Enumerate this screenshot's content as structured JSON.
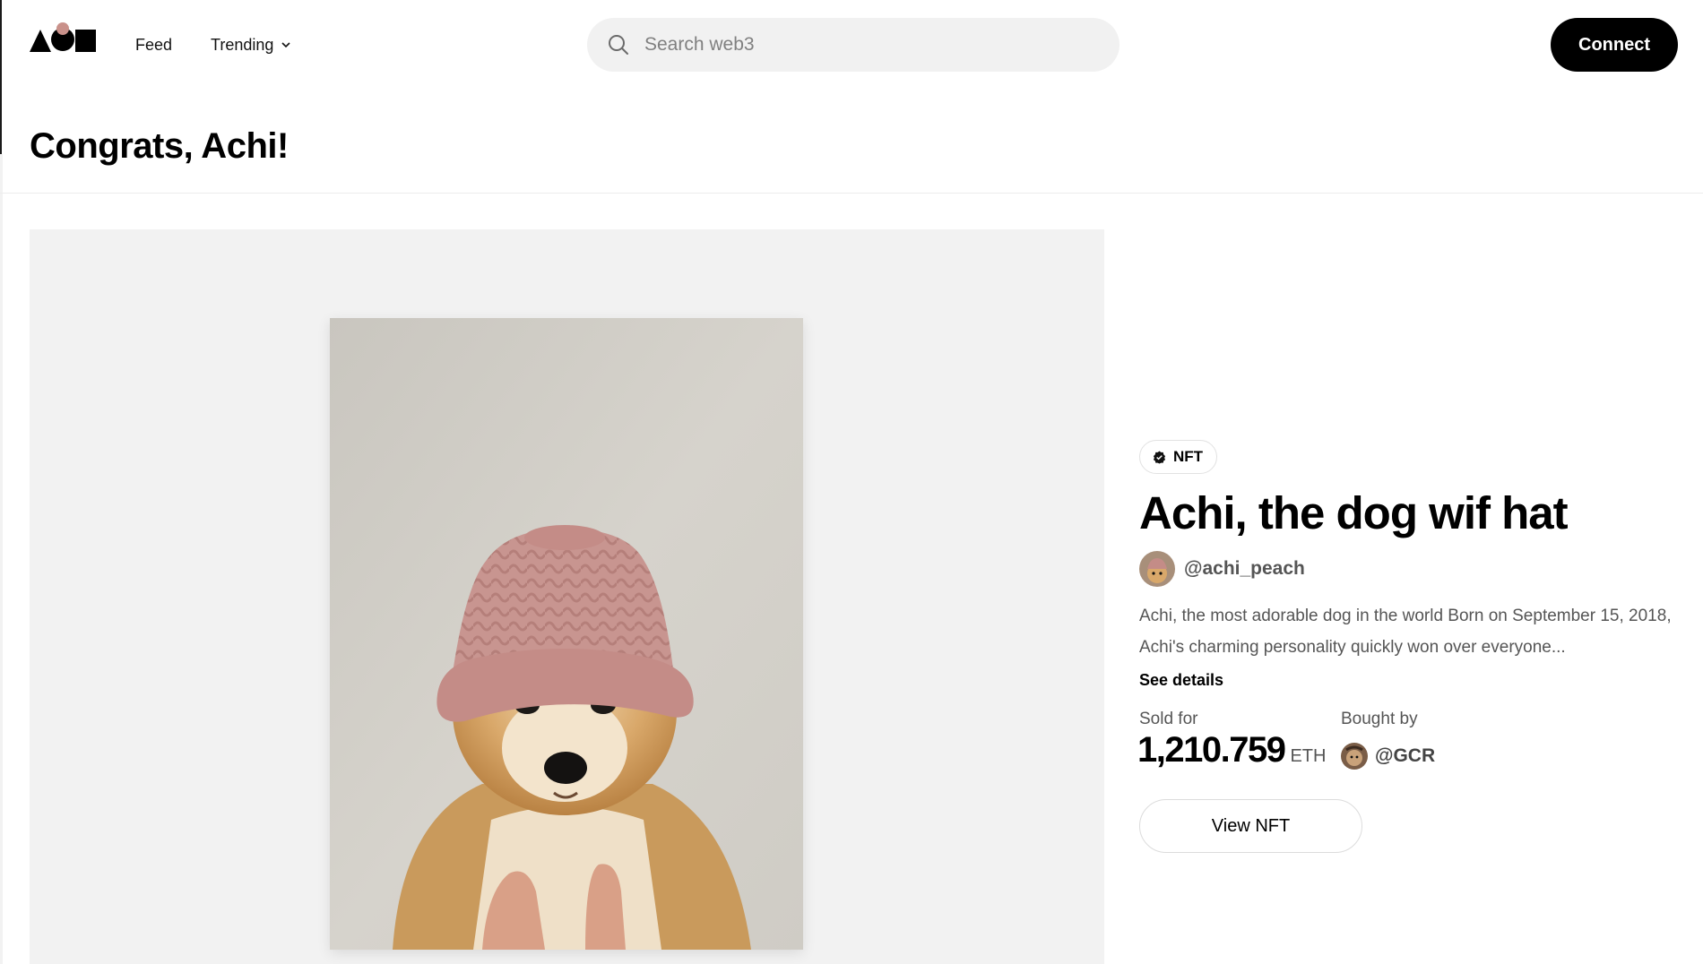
{
  "header": {
    "logo_icon": "geometric-shapes-logo",
    "nav": [
      {
        "label": "Feed"
      },
      {
        "label": "Trending",
        "icon": "chevron-down-icon"
      }
    ],
    "search": {
      "placeholder": "Search web3",
      "icon": "search-icon"
    },
    "connect_label": "Connect"
  },
  "page": {
    "title": "Congrats, Achi!"
  },
  "media": {
    "image_icon": "dog-with-pink-knit-hat-image"
  },
  "nft": {
    "badge_label": "NFT",
    "badge_icon": "verified-check-icon",
    "title": "Achi, the dog wif hat",
    "creator_handle": "@achi_peach",
    "description": "Achi, the most adorable dog in the world Born on September 15, 2018, Achi's charming personality quickly won over everyone...",
    "see_details_label": "See details",
    "sold_for_label": "Sold for",
    "sold_amount": "1,210.759",
    "sold_unit": "ETH",
    "bought_by_label": "Bought by",
    "buyer_handle": "@GCR",
    "view_button_label": "View NFT"
  },
  "colors": {
    "accent": "#000000",
    "panel_bg": "#f2f2f2",
    "search_bg": "#f1f1f1",
    "muted_text": "#555555"
  }
}
